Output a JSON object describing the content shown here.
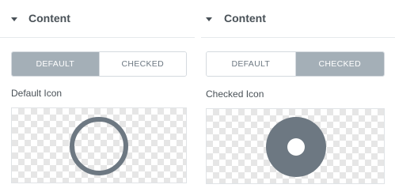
{
  "left_panel": {
    "section_title": "Content",
    "tabs": [
      {
        "label": "DEFAULT",
        "active": true
      },
      {
        "label": "CHECKED",
        "active": false
      }
    ],
    "field_label": "Default Icon",
    "icon": "ring-icon"
  },
  "right_panel": {
    "section_title": "Content",
    "tabs": [
      {
        "label": "DEFAULT",
        "active": false
      },
      {
        "label": "CHECKED",
        "active": true
      }
    ],
    "field_label": "Checked Icon",
    "icon": "dot-circle-icon"
  },
  "colors": {
    "text": "#495157",
    "tab_active_bg": "#a4afb7",
    "icon": "#6d7882"
  }
}
